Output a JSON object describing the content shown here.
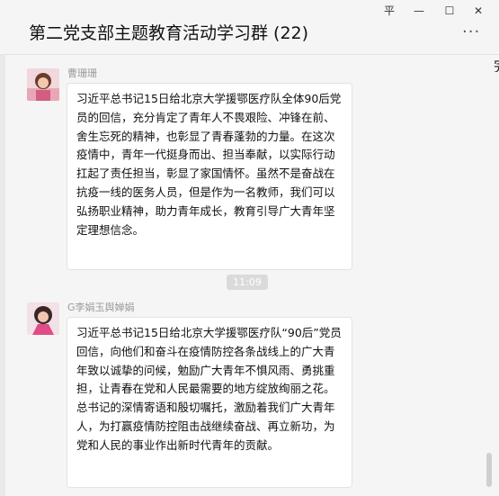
{
  "window": {
    "title": "第二党支部主题教育活动学习群 (22)",
    "controls": {
      "pin": "平",
      "minimize": "—",
      "maximize": "☐",
      "close": "✕"
    },
    "more": "···"
  },
  "edge_text": "完",
  "messages": [
    {
      "sender": "曹珊珊",
      "text": "习近平总书记15日给北京大学援鄂医疗队全体90后党员的回信，充分肯定了青年人不畏艰险、冲锋在前、舍生忘死的精神，也彰显了青春蓬勃的力量。在这次疫情中，青年一代挺身而出、担当奉献，以实际行动扛起了责任担当，彰显了家国情怀。虽然不是奋战在抗疫一线的医务人员，但是作为一名教师，我们可以弘扬职业精神，助力青年成长，教育引导广大青年坚定理想信念。"
    },
    {
      "sender": "G李娟玉舆婵娟",
      "text": "习近平总书记15日给北京大学援鄂医疗队“90后”党员回信，向他们和奋斗在疫情防控各条战线上的广大青年致以诚挚的问候，勉励广大青年不惧风雨、勇挑重担，让青春在党和人民最需要的地方绽放绚丽之花。总书记的深情寄语和殷切嘱托，激励着我们广大青年人，为打赢疫情防控阻击战继续奋战、再立新功，为党和人民的事业作出新时代青年的贡献。"
    }
  ],
  "timestamp": "11:09",
  "colors": {
    "accent": "#f5f5f5",
    "bubble": "#ffffff",
    "time_badge": "#dadada"
  }
}
